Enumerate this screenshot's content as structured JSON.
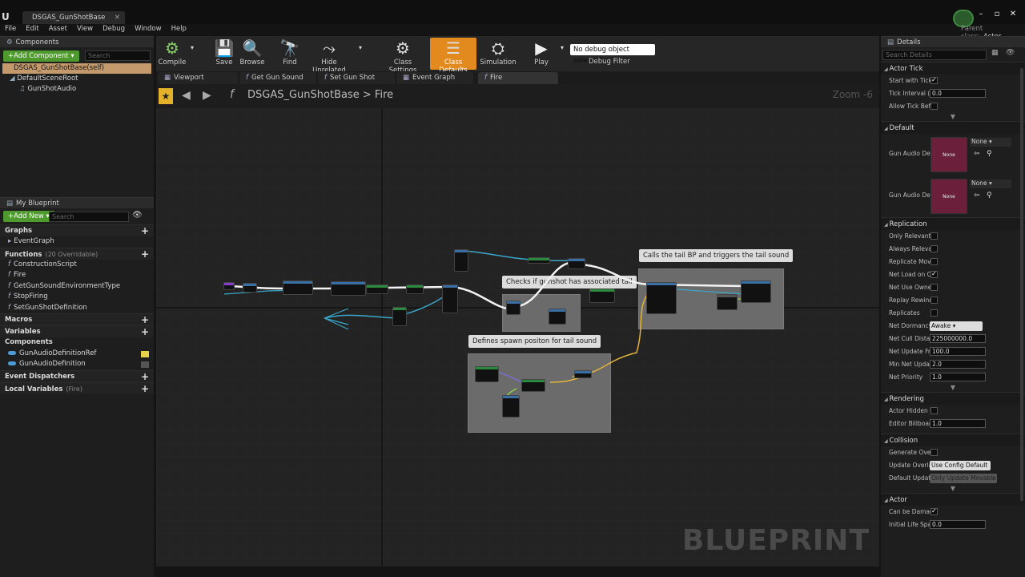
{
  "window": {
    "doc_tab": "DSGAS_GunShotBase",
    "parent_class_label": "Parent class:",
    "parent_class": "Actor"
  },
  "menu": [
    "File",
    "Edit",
    "Asset",
    "View",
    "Debug",
    "Window",
    "Help"
  ],
  "components": {
    "tab": "Components",
    "add_button": "+Add Component ▾",
    "search_placeholder": "Search",
    "self": "DSGAS_GunShotBase(self)",
    "root": "DefaultSceneRoot",
    "child": "GunShotAudio"
  },
  "myblueprint": {
    "tab": "My Blueprint",
    "add_button": "+Add New ▾",
    "search_placeholder": "Search",
    "graphs_header": "Graphs",
    "graphs": [
      "EventGraph"
    ],
    "functions_header": "Functions",
    "functions_sub": "(20 Overridable)",
    "functions": [
      "ConstructionScript",
      "Fire",
      "GetGunSoundEnvironmentType",
      "StopFiring",
      "SetGunShotDefinition"
    ],
    "macros_header": "Macros",
    "variables_header": "Variables",
    "components_header": "Components",
    "variables": [
      "GunAudioDefinitionRef",
      "GunAudioDefinition"
    ],
    "dispatchers_header": "Event Dispatchers",
    "locals_header": "Local Variables",
    "locals_sub": "(Fire)"
  },
  "toolbar": {
    "compile": "Compile",
    "save": "Save",
    "browse": "Browse",
    "find": "Find",
    "hide_unrelated": "Hide Unrelated",
    "class_settings": "Class Settings",
    "class_defaults": "Class Defaults",
    "simulation": "Simulation",
    "play": "Play",
    "debug_select": "No debug object selected ▾",
    "debug_filter": "Debug Filter"
  },
  "graph_tabs": [
    "Viewport",
    "Get Gun Sound Env",
    "Set Gun Shot Defin",
    "Event Graph",
    "Fire"
  ],
  "graph": {
    "crumb_root": "DSGAS_GunShotBase",
    "crumb_sep": ">",
    "crumb_fn": "Fire",
    "zoom": "Zoom -6",
    "watermark": "BLUEPRINT",
    "comments": {
      "tail_bp": "Calls the tail BP and triggers the tail sound",
      "check_tail": "Checks if gunshot has associated tail",
      "spawn_pos": "Defines spawn positon for tail sound"
    }
  },
  "details": {
    "tab": "Details",
    "search_placeholder": "Search Details",
    "actor_tick": {
      "header": "Actor Tick",
      "start_with_tick": "Start with Tick",
      "tick_interval": "Tick Interval (s",
      "tick_interval_val": "0.0",
      "allow_tick": "Allow Tick Bef"
    },
    "default": {
      "header": "Default",
      "gun_audio_1": "Gun Audio Defi",
      "gun_audio_2": "Gun Audio Defi",
      "thumb_none": "None",
      "combo_none": "None"
    },
    "replication": {
      "header": "Replication",
      "only_relevant": "Only Relevant",
      "always_relevant": "Always Releva",
      "replicate_move": "Replicate Mov",
      "net_load": "Net Load on Cl",
      "net_use_owner": "Net Use Owne",
      "replay_rewind": "Replay Rewind",
      "replicates": "Replicates",
      "net_dormancy": "Net Dormancy",
      "net_dormancy_val": "Awake",
      "net_cull": "Net Cull Distan",
      "net_cull_val": "225000000.0",
      "net_update": "Net Update Fre",
      "net_update_val": "100.0",
      "min_net": "Min Net Updat",
      "min_net_val": "2.0",
      "net_priority": "Net Priority",
      "net_priority_val": "1.0"
    },
    "rendering": {
      "header": "Rendering",
      "actor_hidden": "Actor Hidden I",
      "editor_billboard": "Editor Billboar",
      "editor_billboard_val": "1.0"
    },
    "collision": {
      "header": "Collision",
      "generate_overlap": "Generate Over",
      "update_overlap": "Update Overla",
      "update_overlap_val": "Use Config Default ▾",
      "default_update": "Default Update",
      "default_update_val": "Only Update Movable ▾"
    },
    "actor": {
      "header": "Actor",
      "can_be_damaged": "Can be Damag",
      "initial_life": "Initial Life Spa",
      "initial_life_val": "0.0"
    }
  }
}
